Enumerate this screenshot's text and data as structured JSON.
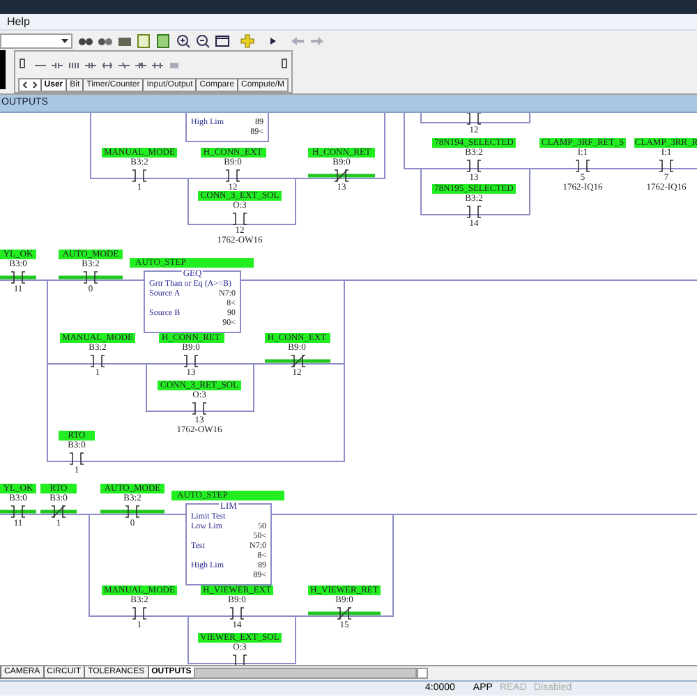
{
  "menu": [
    {
      "label": "Help"
    }
  ],
  "palette_tabs": [
    {
      "label": "User",
      "selected": true
    },
    {
      "label": "Bit",
      "selected": false
    },
    {
      "label": "Timer/Counter",
      "selected": false
    },
    {
      "label": "Input/Output",
      "selected": false
    },
    {
      "label": "Compare",
      "selected": false
    },
    {
      "label": "Compute/M",
      "selected": false
    }
  ],
  "routine_title": "OUTPUTS",
  "instructions": [
    {
      "kind": "contact",
      "tag": "MANUAL_MODE",
      "address": "B3:2",
      "bit": "1",
      "normally_closed": false,
      "energized": false
    },
    {
      "kind": "contact",
      "tag": "H_CONN_EXT",
      "address": "B9:0",
      "bit": "12",
      "normally_closed": false,
      "energized": false
    },
    {
      "kind": "contact",
      "tag": "CONN_3_EXT_SOL",
      "address": "O:3",
      "bit": "12",
      "module": "1762-OW16",
      "normally_closed": false,
      "energized": false
    },
    {
      "kind": "contact",
      "tag": "H_CONN_RET",
      "address": "B9:0",
      "bit": "13",
      "normally_closed": true,
      "energized": true
    },
    {
      "kind": "contact",
      "bit": "12",
      "normally_closed": false,
      "energized": false
    },
    {
      "kind": "contact",
      "tag": "78N194_SELECTED",
      "address": "B3:2",
      "bit": "13",
      "normally_closed": false,
      "energized": false
    },
    {
      "kind": "contact",
      "tag": "78N195_SELECTED",
      "address": "B3:2",
      "bit": "14",
      "normally_closed": false,
      "energized": false
    },
    {
      "kind": "contact",
      "tag": "CLAMP_3RF_RET_S",
      "address": "I:1",
      "bit": "5",
      "module": "1762-IQ16",
      "normally_closed": false,
      "energized": false
    },
    {
      "kind": "contact",
      "tag": "CLAMP_3RR_R",
      "address": "I:1",
      "bit": "7",
      "module": "1762-IQ16",
      "normally_closed": false,
      "energized": false
    },
    {
      "kind": "contact",
      "tag": "YL_OK",
      "address": "B3:0",
      "bit": "11",
      "normally_closed": false,
      "energized": true
    },
    {
      "kind": "contact",
      "tag": "AUTO_MODE",
      "address": "B3:2",
      "bit": "0",
      "normally_closed": false,
      "energized": true
    },
    {
      "kind": "contact",
      "tag": "MANUAL_MODE",
      "address": "B3:2",
      "bit": "1",
      "normally_closed": false,
      "energized": false
    },
    {
      "kind": "contact",
      "tag": "H_CONN_RET",
      "address": "B9:0",
      "bit": "13",
      "normally_closed": false,
      "energized": false
    },
    {
      "kind": "contact",
      "tag": "H_CONN_EXT",
      "address": "B9:0",
      "bit": "12",
      "normally_closed": true,
      "energized": true
    },
    {
      "kind": "contact",
      "tag": "CONN_3_RET_SOL",
      "address": "O:3",
      "bit": "13",
      "module": "1762-OW16",
      "normally_closed": false,
      "energized": false
    },
    {
      "kind": "contact",
      "tag": "RTO",
      "address": "B3:0",
      "bit": "1",
      "normally_closed": false,
      "energized": false
    },
    {
      "kind": "contact",
      "tag": "YL_OK",
      "address": "B3:0",
      "bit": "11",
      "normally_closed": false,
      "energized": true
    },
    {
      "kind": "contact",
      "tag": "RTO",
      "address": "B3:0",
      "bit": "1",
      "normally_closed": true,
      "energized": true
    },
    {
      "kind": "contact",
      "tag": "AUTO_MODE",
      "address": "B3:2",
      "bit": "0",
      "normally_closed": false,
      "energized": true
    },
    {
      "kind": "contact",
      "tag": "MANUAL_MODE",
      "address": "B3:2",
      "bit": "1",
      "normally_closed": false,
      "energized": false
    },
    {
      "kind": "contact",
      "tag": "H_VIEWER_EXT",
      "address": "B9:0",
      "bit": "14",
      "normally_closed": false,
      "energized": false
    },
    {
      "kind": "contact",
      "tag": "H_VIEWER_RET",
      "address": "B9:0",
      "bit": "15",
      "normally_closed": true,
      "energized": true
    },
    {
      "kind": "contact",
      "tag": "VIEWER_EXT_SOL",
      "address": "O:3",
      "normally_closed": false,
      "energized": false
    }
  ],
  "blocks": [
    {
      "rows": [
        {
          "label": "High Lim",
          "value": "89"
        },
        {
          "value": "89<"
        }
      ]
    },
    {
      "tag": "AUTO_STEP",
      "title": "GEQ",
      "rows": [
        {
          "label": "Grtr Than or Eq (A>=B)"
        },
        {
          "label": "Source A",
          "value": "N7:0"
        },
        {
          "value": "8<"
        },
        {
          "label": "Source B",
          "value": "90"
        },
        {
          "value": "90<"
        }
      ]
    },
    {
      "tag": "AUTO_STEP",
      "title": "LIM",
      "rows": [
        {
          "label": "Limit Test"
        },
        {
          "label": "Low Lim",
          "value": "50"
        },
        {
          "value": "50<"
        },
        {
          "label": "Test",
          "value": "N7:0"
        },
        {
          "value": "8<"
        },
        {
          "label": "High Lim",
          "value": "89"
        },
        {
          "value": "89<"
        }
      ]
    }
  ],
  "sheet_tabs": [
    {
      "label": "CAMERA",
      "selected": false
    },
    {
      "label": "CIRCUIT",
      "selected": false
    },
    {
      "label": "TOLERANCES",
      "selected": false
    },
    {
      "label": "OUTPUTS",
      "selected": true
    }
  ],
  "status_bar": {
    "position": "4:0000",
    "mode": "APP",
    "access": "READ",
    "edits": "Disabled"
  }
}
